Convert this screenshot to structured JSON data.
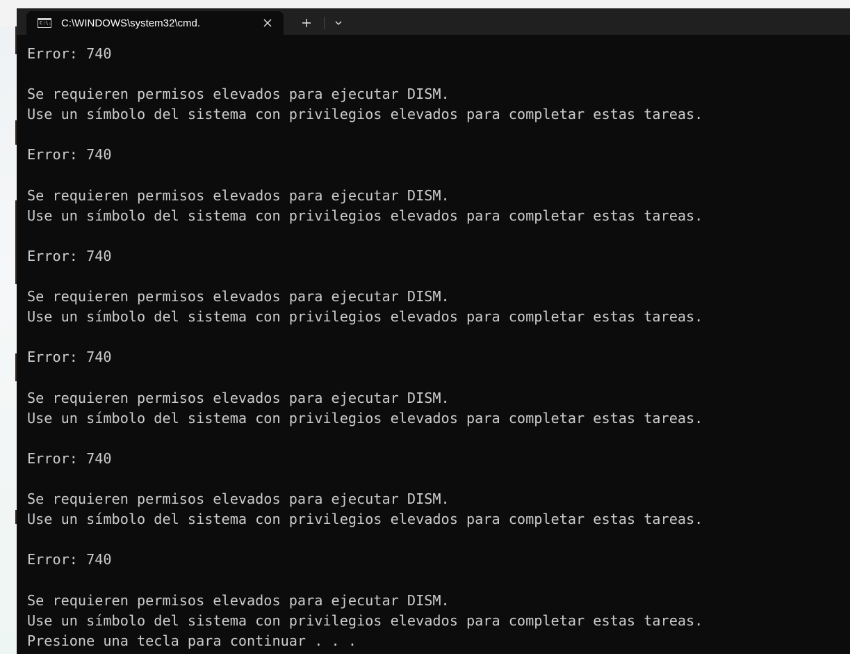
{
  "window": {
    "tab_title": "C:\\WINDOWS\\system32\\cmd.",
    "tab_icon": "cmd-prompt-icon",
    "tab_icon_glyph": "C:\\.",
    "close_icon": "close-icon",
    "new_tab_icon": "plus-icon",
    "dropdown_icon": "chevron-down-icon"
  },
  "colors": {
    "console_background": "#0c0c0c",
    "console_text": "#cccccc",
    "tabbar_background": "#202020",
    "tab_text": "#ffffff"
  },
  "console": {
    "lines": [
      "Error: 740",
      "",
      "Se requieren permisos elevados para ejecutar DISM.",
      "Use un símbolo del sistema con privilegios elevados para completar estas tareas.",
      "",
      "Error: 740",
      "",
      "Se requieren permisos elevados para ejecutar DISM.",
      "Use un símbolo del sistema con privilegios elevados para completar estas tareas.",
      "",
      "Error: 740",
      "",
      "Se requieren permisos elevados para ejecutar DISM.",
      "Use un símbolo del sistema con privilegios elevados para completar estas tareas.",
      "",
      "Error: 740",
      "",
      "Se requieren permisos elevados para ejecutar DISM.",
      "Use un símbolo del sistema con privilegios elevados para completar estas tareas.",
      "",
      "Error: 740",
      "",
      "Se requieren permisos elevados para ejecutar DISM.",
      "Use un símbolo del sistema con privilegios elevados para completar estas tareas.",
      "",
      "Error: 740",
      "",
      "Se requieren permisos elevados para ejecutar DISM.",
      "Use un símbolo del sistema con privilegios elevados para completar estas tareas.",
      "Presione una tecla para continuar . . ."
    ]
  }
}
